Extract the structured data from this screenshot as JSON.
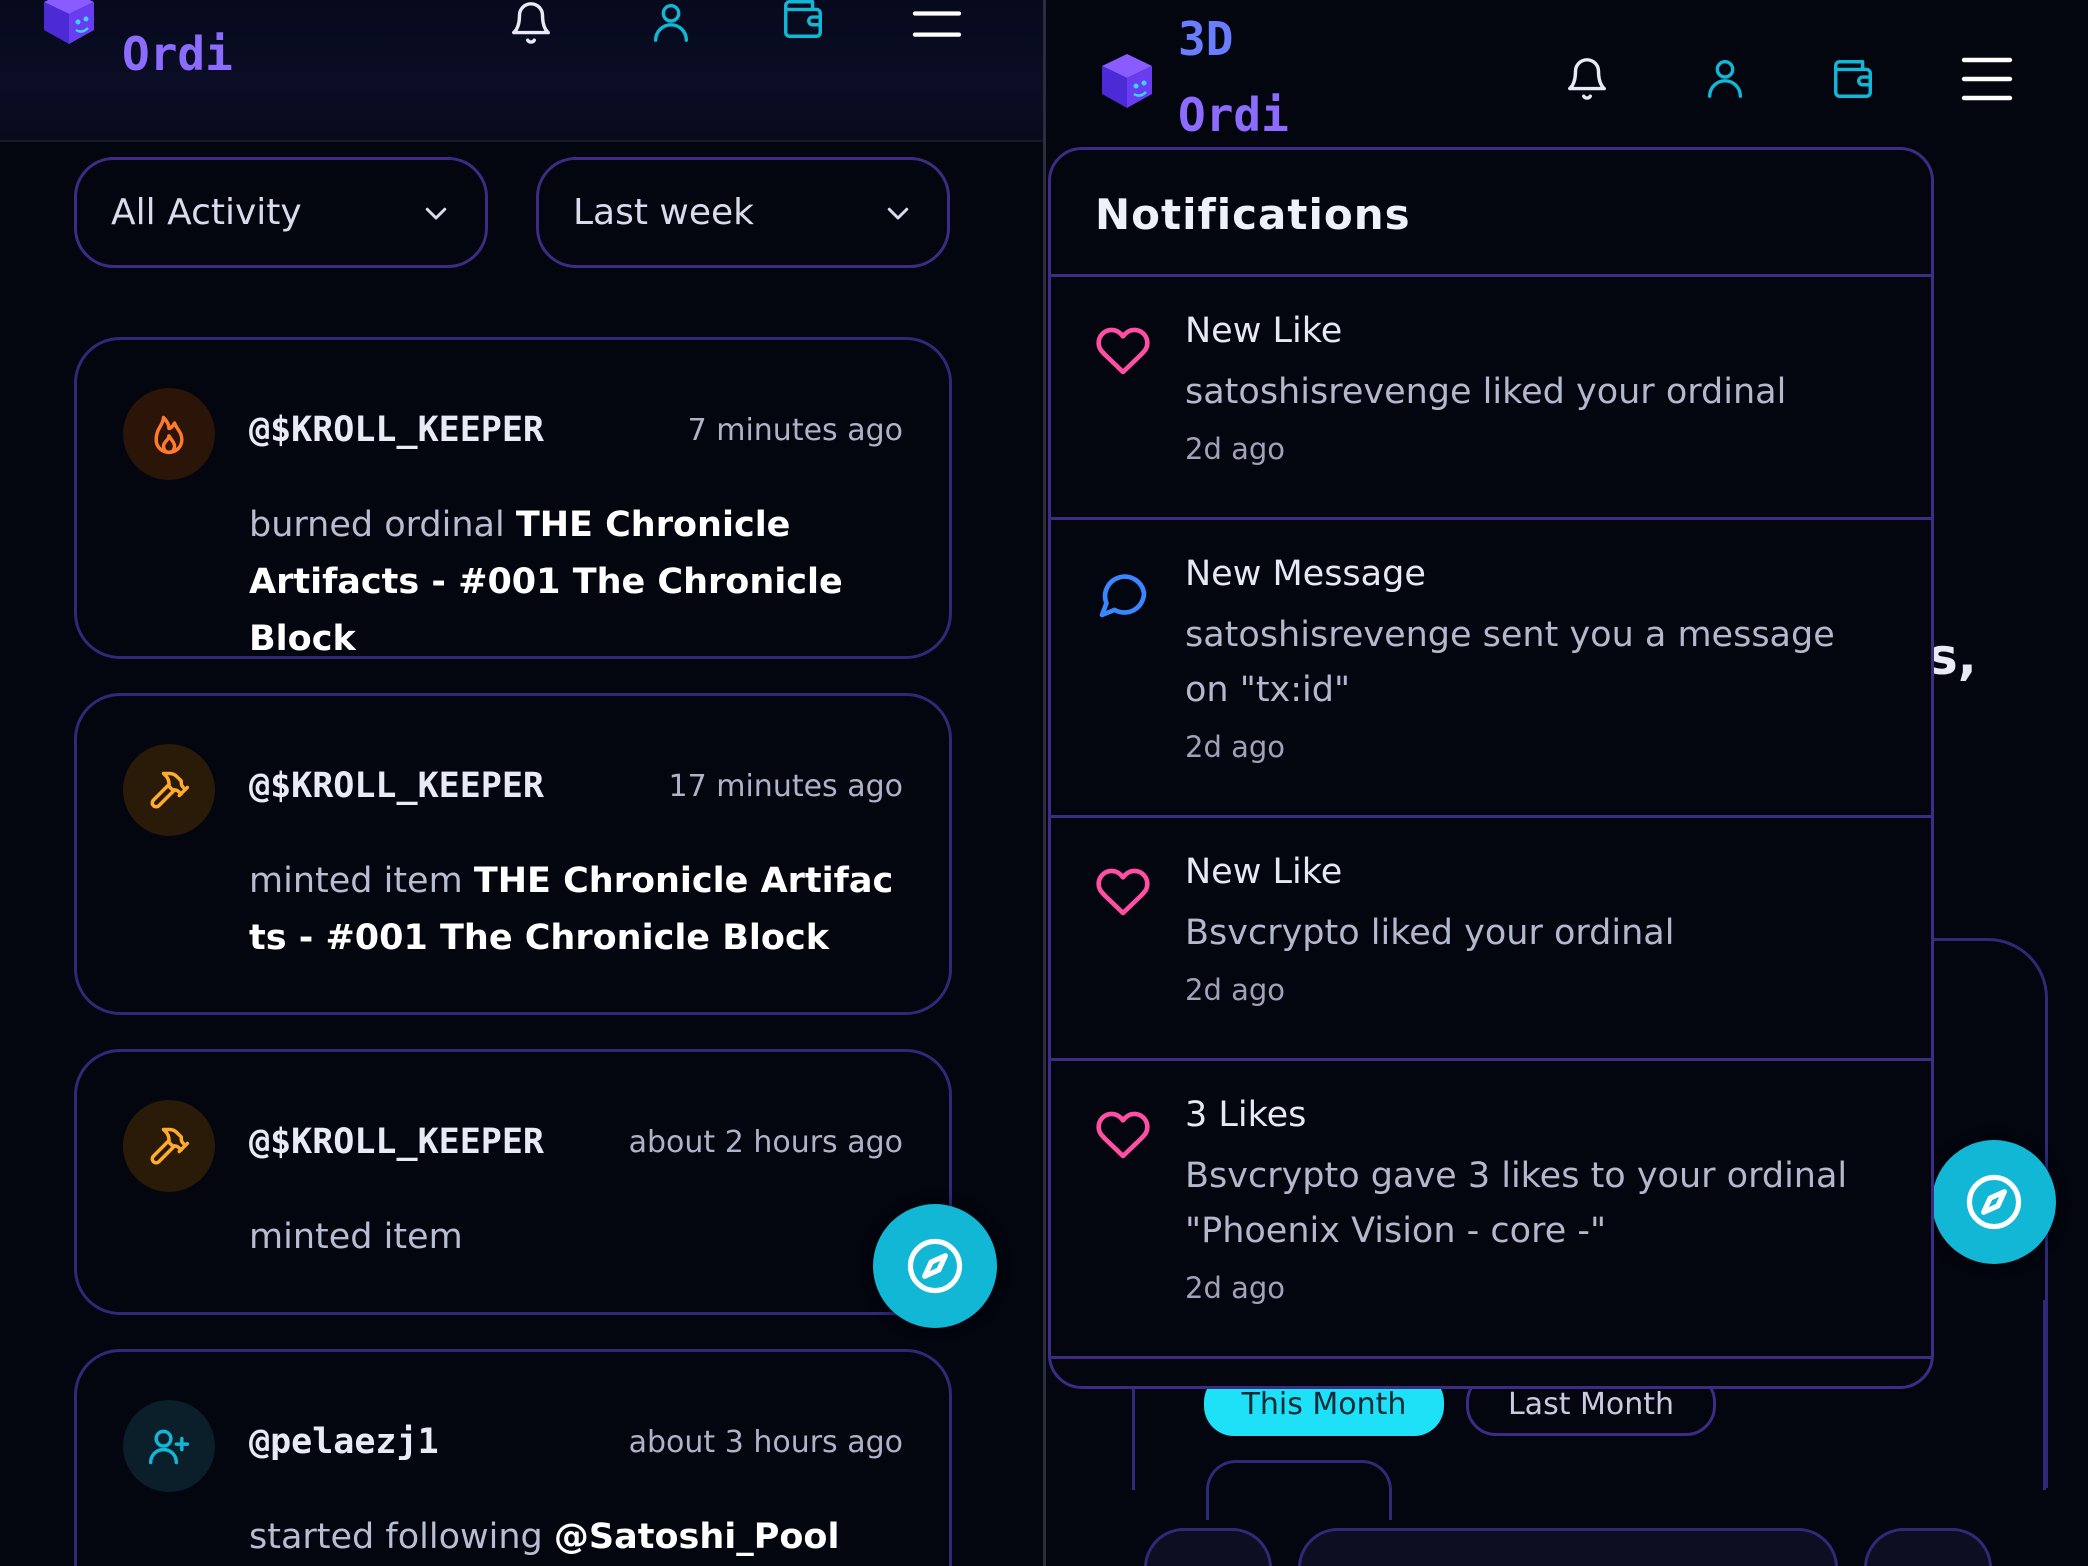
{
  "left": {
    "logo_text": "Ordi",
    "filters": {
      "activity": "All Activity",
      "range": "Last week"
    },
    "activities": [
      {
        "user": "@$KROLL_KEEPER",
        "time": "7 minutes ago",
        "action": "burned ordinal",
        "item": "THE Chronicle Artifacts - #001 The Chronicle Block",
        "icon": "flame-icon"
      },
      {
        "user": "@$KROLL_KEEPER",
        "time": "17 minutes ago",
        "action": "minted item",
        "item": "THE Chronicle Artifacts - #001 The Chronicle Block",
        "icon": "hammer-icon"
      },
      {
        "user": "@$KROLL_KEEPER",
        "time": "about 2 hours ago",
        "action": "minted item",
        "item": "",
        "icon": "hammer-icon"
      },
      {
        "user": "@pelaezj1",
        "time": "about 3 hours ago",
        "action": "started following",
        "item": "@Satoshi_Pool",
        "icon": "user-plus-icon"
      }
    ]
  },
  "right": {
    "logo_text_line1": "3D",
    "logo_text_line2": "Ordi",
    "background": {
      "pill_this_month": "This Month",
      "pill_last_month": "Last Month",
      "fragment_text": "s,"
    },
    "notifications": {
      "title": "Notifications",
      "items": [
        {
          "icon": "heart-icon",
          "title": "New Like",
          "text": "satoshisrevenge liked your ordinal",
          "time": "2d ago"
        },
        {
          "icon": "message-icon",
          "title": "New Message",
          "text": "satoshisrevenge sent you a message on \"tx:id\"",
          "time": "2d ago"
        },
        {
          "icon": "heart-icon",
          "title": "New Like",
          "text": "Bsvcrypto liked your ordinal",
          "time": "2d ago"
        },
        {
          "icon": "heart-icon",
          "title": "3 Likes",
          "text": "Bsvcrypto gave 3 likes to your ordinal \"Phoenix Vision - core -\"",
          "time": "2d ago"
        }
      ]
    }
  },
  "colors": {
    "accent_cyan": "#13b7d6",
    "border_purple": "#3c2c84",
    "heart_pink": "#ff4fa3",
    "message_blue": "#3a86ff"
  }
}
